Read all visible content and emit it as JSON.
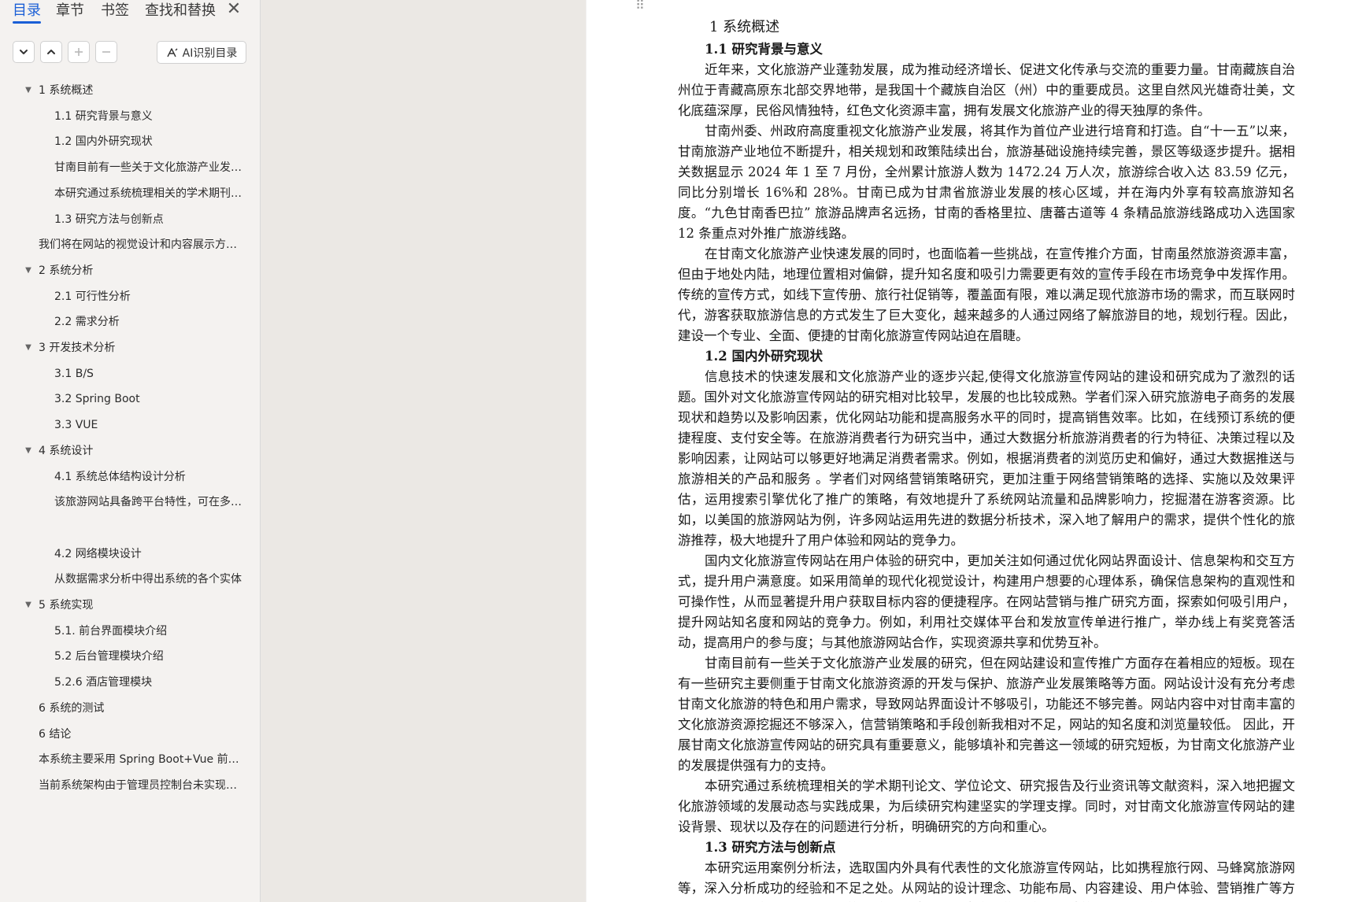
{
  "nav": {
    "tabs": [
      "目录",
      "章节",
      "书签",
      "查找和替换"
    ],
    "active_tab": "目录",
    "close_label": "✕",
    "toolbar": {
      "expand_icon": "chevron-down-icon",
      "collapse_icon": "chevron-up-icon",
      "add_icon": "plus-icon",
      "remove_icon": "minus-icon",
      "ai_label": "AI识别目录"
    },
    "toc": [
      {
        "label": "1 系统概述",
        "level": 1,
        "expandable": true
      },
      {
        "label": "1.1 研究背景与意义",
        "level": 2
      },
      {
        "label": "1.2  国内外研究现状",
        "level": 2
      },
      {
        "label": "甘南目前有一些关于文化旅游产业发展的研究，但在网站建设和宣传推广方面存在着相应的短板。",
        "level": 2
      },
      {
        "label": "本研究通过系统梳理相关的学术期刊论文、学位论文、研究报告及行业资讯等文献资料",
        "level": 2
      },
      {
        "label": "1.3 研究方法与创新点",
        "level": 2
      },
      {
        "label": "我们将在网站的视觉设计和内容展示方面进行创新",
        "level": 1
      },
      {
        "label": "2 系统分析",
        "level": 1,
        "expandable": true
      },
      {
        "label": "2.1  可行性分析",
        "level": 2
      },
      {
        "label": "2.2  需求分析",
        "level": 2
      },
      {
        "label": "3  开发技术分析",
        "level": 1,
        "expandable": true
      },
      {
        "label": "3.1 B/S",
        "level": 2
      },
      {
        "label": "3.2 Spring Boot",
        "level": 2
      },
      {
        "label": "3.3 VUE",
        "level": 2
      },
      {
        "label": "4  系统设计",
        "level": 1,
        "expandable": true
      },
      {
        "label": "4.1  系统总体结构设计分析",
        "level": 2
      },
      {
        "label": "该旅游网站具备跨平台特性，可在多种设备上访问",
        "level": 2
      },
      {
        "label": "",
        "level": 2
      },
      {
        "label": "4.2  网络模块设计",
        "level": 2
      },
      {
        "label": "从数据需求分析中得出系统的各个实体",
        "level": 2
      },
      {
        "label": "5  系统实现",
        "level": 1,
        "expandable": true
      },
      {
        "label": "5.1.  前台界面模块介绍",
        "level": 2
      },
      {
        "label": "5.2 后台管理模块介绍",
        "level": 2
      },
      {
        "label": "5.2.6  酒店管理模块",
        "level": 2
      },
      {
        "label": "6 系统的测试",
        "level": 1
      },
      {
        "label": "6 结论",
        "level": 1
      },
      {
        "label": "本系统主要采用 Spring Boot+Vue 前后端分离架构",
        "level": 1
      },
      {
        "label": "当前系统架构由于管理员控制台未实现的功能",
        "level": 1
      }
    ]
  },
  "doc": {
    "blocks": [
      {
        "type": "h1",
        "text": "1 系统概述"
      },
      {
        "type": "h2",
        "text": "1.1 研究背景与意义"
      },
      {
        "type": "p",
        "text": "近年来，文化旅游产业蓬勃发展，成为推动经济增长、促进文化传承与交流的重要力量。甘南藏族自治州位于青藏高原东北部交界地带，是我国十个藏族自治区（州）中的重要成员。这里自然风光雄奇壮美，文化底蕴深厚，民俗风情独特，红色文化资源丰富，拥有发展文化旅游产业的得天独厚的条件。"
      },
      {
        "type": "p",
        "text": "甘南州委、州政府高度重视文化旅游产业发展，将其作为首位产业进行培育和打造。自“十一五”以来，甘南旅游产业地位不断提升，相关规划和政策陆续出台，旅游基础设施持续完善，景区等级逐步提升。据相关数据显示 2024 年 1 至 7 月份，全州累计旅游人数为 1472.24 万人次，旅游综合收入达 83.59 亿元，同比分别增长 16%和 28%。甘南已成为甘肃省旅游业发展的核心区域，并在海内外享有较高旅游知名度。“九色甘南香巴拉” 旅游品牌声名远扬，甘南的香格里拉、唐蕃古道等 4 条精品旅游线路成功入选国家 12 条重点对外推广旅游线路。"
      },
      {
        "type": "p",
        "text": "在甘南文化旅游产业快速发展的同时，也面临着一些挑战，在宣传推介方面，甘南虽然旅游资源丰富，但由于地处内陆，地理位置相对偏僻，提升知名度和吸引力需要更有效的宣传手段在市场竞争中发挥作用。传统的宣传方式，如线下宣传册、旅行社促销等，覆盖面有限，难以满足现代旅游市场的需求，而互联网时代，游客获取旅游信息的方式发生了巨大变化，越来越多的人通过网络了解旅游目的地，规划行程。因此，建设一个专业、全面、便捷的甘南化旅游宣传网站迫在眉睫。"
      },
      {
        "type": "h2",
        "text": "1.2  国内外研究现状"
      },
      {
        "type": "p",
        "text": "信息技术的快速发展和文化旅游产业的逐步兴起,使得文化旅游宣传网站的建设和研究成为了激烈的话题。国外对文化旅游宣传网站的研究相对比较早，发展的也比较成熟。学者们深入研究旅游电子商务的发展现状和趋势以及影响因素，优化网站功能和提高服务水平的同时，提高销售效率。比如，在线预订系统的便捷程度、支付安全等。在旅游消费者行为研究当中，通过大数据分析旅游消费者的行为特征、决策过程以及影响因素，让网站可以够更好地满足消费者需求。例如，根据消费者的浏览历史和偏好，通过大数据推送与旅游相关的产品和服务 。学者们对网络营销策略研究，更加注重于网络营销策略的选择、实施以及效果评估，运用搜索引擎优化了推广的策略，有效地提升了系统网站流量和品牌影响力，挖掘潜在游客资源。比如，以美国的旅游网站为例，许多网站运用先进的数据分析技术，深入地了解用户的需求，提供个性化的旅游推荐，极大地提升了用户体验和网站的竞争力。"
      },
      {
        "type": "p",
        "text": "国内文化旅游宣传网站在用户体验的研究中，更加关注如何通过优化网站界面设计、信息架构和交互方式，提升用户满意度。如采用简单的现代化视觉设计，构建用户想要的心理体系，确保信息架构的直观性和可操作性，从而显著提升用户获取目标内容的便捷程序。在网站营销与推广研究方面，探索如何吸引用户，提升网站知名度和网站的竞争力。例如，利用社交媒体平台和发放宣传单进行推广，举办线上有奖竞答活动，提高用户的参与度；与其他旅游网站合作，实现资源共享和优势互补。"
      },
      {
        "type": "p",
        "text": "甘南目前有一些关于文化旅游产业发展的研究，但在网站建设和宣传推广方面存在着相应的短板。现在有一些研究主要侧重于甘南文化旅游资源的开发与保护、旅游产业发展策略等方面。网站设计没有充分考虑甘南文化旅游的特色和用户需求，导致网站界面设计不够吸引，功能还不够完善。网站内容中对甘南丰富的文化旅游资源挖掘还不够深入，信营销策略和手段创新我相对不足，网站的知名度和浏览量较低。 因此，开展甘南文化旅游宣传网站的研究具有重要意义，能够填补和完善这一领域的研究短板，为甘南文化旅游产业的发展提供强有力的支持。"
      },
      {
        "type": "p",
        "text": "本研究通过系统梳理相关的学术期刊论文、学位论文、研究报告及行业资讯等文献资料，深入地把握文化旅游领域的发展动态与实践成果，为后续研究构建坚实的学理支撑。同时，对甘南文化旅游宣传网站的建设背景、现状以及存在的问题进行分析，明确研究的方向和重心。"
      },
      {
        "type": "h2",
        "text": "1.3 研究方法与创新点"
      },
      {
        "type": "p",
        "text": "本研究运用案例分析法，选取国内外具有代表性的文化旅游宣传网站，比如携程旅行网、马蜂窝旅游网等，深入分析成功的经验和不足之处。从网站的设计理念、功能布局、内容建设、用户体验、营销推广等方面进行对比研究，总结可借鉴的经验和做法，为甘南文化旅游宣传网站的建设提供参考。"
      }
    ]
  }
}
